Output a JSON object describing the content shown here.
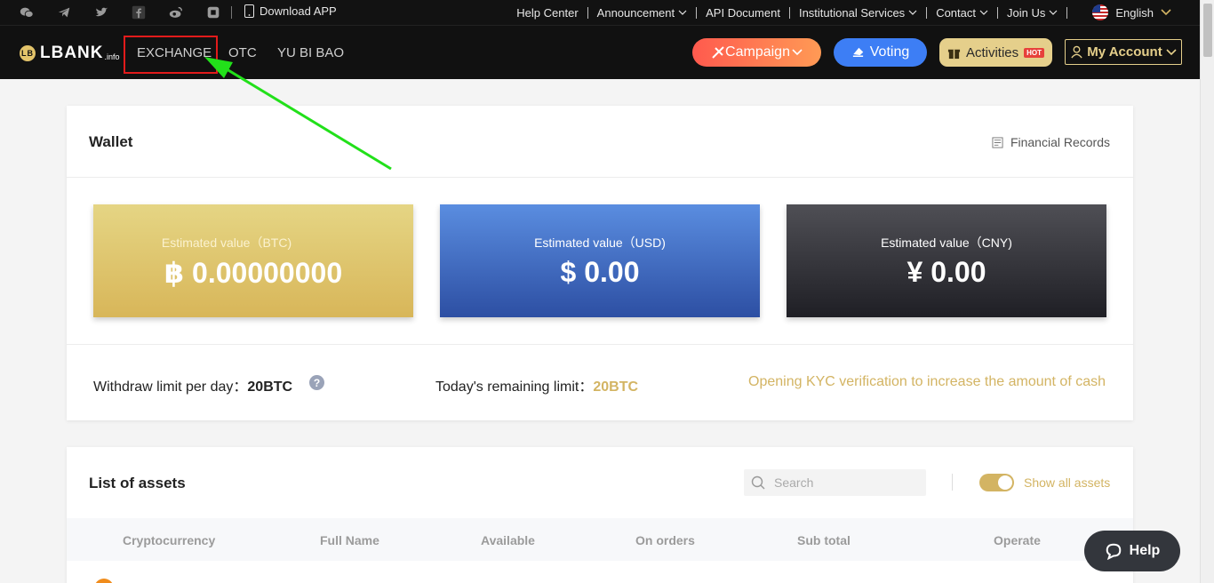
{
  "topbar": {
    "download_app": "Download APP",
    "links": [
      "Help Center",
      "Announcement",
      "API Document",
      "Institutional Services",
      "Contact",
      "Join Us"
    ],
    "language": "English"
  },
  "nav": {
    "logo_text": "LBANK",
    "logo_suffix": ".info",
    "links": [
      "EXCHANGE",
      "OTC",
      "YU BI BAO"
    ],
    "campaign": "Campaign",
    "voting": "Voting",
    "activities": "Activities",
    "hot_badge": "HOT",
    "my_account": "My Account"
  },
  "wallet": {
    "title": "Wallet",
    "financial_records": "Financial Records",
    "btc": {
      "label": "Estimated value（BTC)",
      "symbol": "฿",
      "value": "0.00000000"
    },
    "usd": {
      "label": "Estimated value（USD)",
      "symbol": "$",
      "value": "0.00"
    },
    "cny": {
      "label": "Estimated value（CNY)",
      "symbol": "¥",
      "value": "0.00"
    },
    "withdraw_label": "Withdraw limit per day：",
    "withdraw_value": "20BTC",
    "remaining_label": "Today's remaining limit：",
    "remaining_value": "20BTC",
    "kyc_text": "Opening KYC verification to increase the amount of cash",
    "help_mark": "?"
  },
  "assets": {
    "title": "List of assets",
    "search_placeholder": "Search",
    "show_all": "Show all assets",
    "show_all_on": true,
    "columns": [
      "Cryptocurrency",
      "Full Name",
      "Available",
      "On orders",
      "Sub total",
      "Operate"
    ]
  },
  "help_button": "Help",
  "colors": {
    "accent_gold": "#d3b463",
    "annotation_green": "#22e01a",
    "annotation_red": "#e21b1b"
  }
}
